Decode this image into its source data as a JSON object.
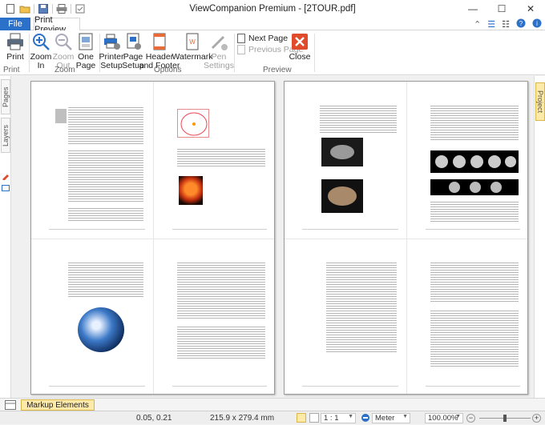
{
  "window": {
    "title": "ViewCompanion Premium - [2TOUR.pdf]",
    "buttons": [
      "minimize",
      "maximize",
      "close"
    ]
  },
  "tabs": {
    "file": "File",
    "print_preview": "Print Preview"
  },
  "ribbon": {
    "print": {
      "print": "Print"
    },
    "zoom": {
      "zoom_in": "Zoom\nIn",
      "zoom_out": "Zoom\nOut",
      "one_page": "One\nPage",
      "label": "Zoom"
    },
    "options": {
      "printer_setup": "Printer\nSetup",
      "page_setup": "Page\nSetup",
      "header_footer": "Header\nand Footer",
      "watermark": "Watermark",
      "pen_settings": "Pen\nSettings",
      "label": "Options"
    },
    "preview": {
      "next_page": "Next Page",
      "previous_page": "Previous Page",
      "close": "Close",
      "label": "Preview"
    },
    "first_group_label": "Print"
  },
  "side_panels": {
    "left": [
      "Pages",
      "Layers"
    ],
    "right": [
      "Project"
    ]
  },
  "bottom_tab": "Markup Elements",
  "status": {
    "coords": "0.05, 0.21",
    "page_size": "215.9 x 279.4 mm",
    "scale": "1 : 1",
    "units": "Meter",
    "zoom": "100.00%"
  },
  "colors": {
    "file_tab": "#2b70c9",
    "close_button": "#e04b2c",
    "accent_tab": "#fde9a8"
  },
  "icons": {
    "help": "question-icon",
    "info": "info-icon",
    "lock": "lock-icon"
  }
}
